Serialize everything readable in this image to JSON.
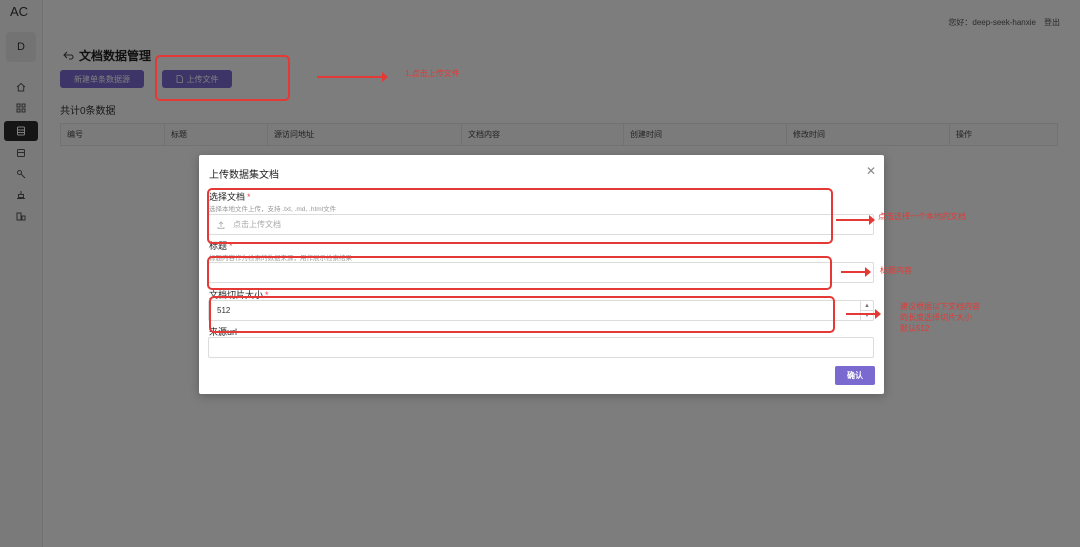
{
  "app": {
    "logo": "AC",
    "avatar": "D"
  },
  "sidebar": {
    "items": [
      {
        "icon": "home-icon"
      },
      {
        "icon": "grid-icon"
      },
      {
        "icon": "database-icon",
        "active": true
      },
      {
        "icon": "document-icon"
      },
      {
        "icon": "key-icon"
      },
      {
        "icon": "layers-icon"
      },
      {
        "icon": "plugin-icon"
      }
    ]
  },
  "header": {
    "greeting": "您好：deep-seek-hanxie",
    "logout": "登出"
  },
  "page": {
    "title": "文档数据管理",
    "new_button": "新建单条数据源",
    "upload_button": "上传文件",
    "count_text": "共计0条数据"
  },
  "table": {
    "columns": [
      "编号",
      "标题",
      "源访问地址",
      "文档内容",
      "创建时间",
      "修改时间",
      "操作"
    ]
  },
  "modal": {
    "title": "上传数据集文档",
    "file_label": "选择文档",
    "file_hint": "选择本地文件上传，支持 .txt, .md, .html文件",
    "file_placeholder": "点击上传文档",
    "title_label": "标题",
    "title_hint": "标题内容作为检索的数据来源，用作展示检索结果",
    "title_value": "",
    "chunk_label": "文档切片大小",
    "chunk_value": "512",
    "source_label": "来源url",
    "source_value": "",
    "confirm": "确认"
  },
  "annotations": {
    "upload_note": "1.点击上传文件",
    "file_note": "点击选择一个本地的文档",
    "title_note": "标题内容",
    "chunk_note": [
      "建议根据以下文档内容",
      "的长度选择切片大小",
      "默认512"
    ]
  },
  "colors": {
    "primary": "#7a6ad0",
    "annotation": "#e53935"
  }
}
